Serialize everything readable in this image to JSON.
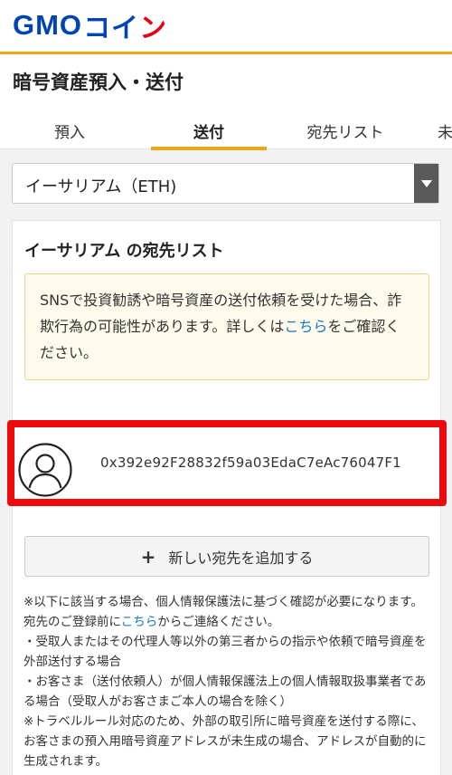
{
  "header": {
    "logo_gmo": "GMO",
    "logo_coin_1": "コイ",
    "logo_coin_2": "ン"
  },
  "page_title": "暗号資産預入・送付",
  "tabs": [
    {
      "label": "預入"
    },
    {
      "label": "送付"
    },
    {
      "label": "宛先リスト"
    },
    {
      "label": "未"
    }
  ],
  "currency_select": {
    "value": "イーサリアム（ETH)"
  },
  "card": {
    "title": "イーサリアム の宛先リスト",
    "warning_text": "SNSで投資勧誘や暗号資産の送付依頼を受けた場合、詐欺行為の可能性があります。詳しくは",
    "warning_link": "こちら",
    "warning_tail": "をご確認ください。",
    "address": "0x392e92F28832f59a03EdaC7eAc76047F1",
    "add_button": "新しい宛先を追加する",
    "notes": {
      "line1_pre": "※以下に該当する場合、個人情報保護法に基づく確認が必要になります。宛先のご登録前に",
      "line1_link": "こちら",
      "line1_post": "からご連絡ください。",
      "line2": "・受取人またはその代理人等以外の第三者からの指示や依頼で暗号資産を外部送付する場合",
      "line3": "・お客さま（送付依頼人）が個人情報保護法上の個人情報取扱事業者である場合（受取人がお客さまご本人の場合を除く）",
      "line4": "※トラベルルール対応のため、外部の取引所に暗号資産を送付する際に、お客さまの預入用暗号資産アドレスが未生成の場合、アドレスが自動的に生成されます。"
    }
  },
  "colors": {
    "brand_blue": "#0044b3",
    "accent": "#e8a817",
    "highlight_red": "#ee0b0b",
    "link": "#1a78c2"
  }
}
